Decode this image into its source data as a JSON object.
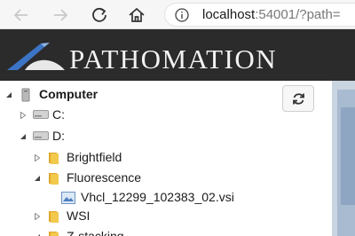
{
  "browser": {
    "url_host": "localhost",
    "url_rest": ":54001/?path="
  },
  "header": {
    "logo_text": "PATHOMATION"
  },
  "tree": {
    "items": [
      {
        "label": "Computer",
        "expanded": true,
        "icon": "computer-icon"
      },
      {
        "label": "C:",
        "expanded": false,
        "icon": "drive-icon"
      },
      {
        "label": "D:",
        "expanded": true,
        "icon": "drive-icon"
      },
      {
        "label": "Brightfield",
        "expanded": false,
        "icon": "folder-icon"
      },
      {
        "label": "Fluorescence",
        "expanded": true,
        "icon": "folder-icon"
      },
      {
        "label": "Vhcl_12299_102383_02.vsi",
        "icon": "slide-file-icon"
      },
      {
        "label": "WSI",
        "expanded": false,
        "icon": "folder-icon"
      },
      {
        "label": "Z-stacking",
        "expanded": true,
        "icon": "folder-icon"
      }
    ]
  },
  "colors": {
    "header_bg": "#2b2b2b",
    "logo_blue": "#3c74c5",
    "folder_yellow": "#f2c94c"
  }
}
